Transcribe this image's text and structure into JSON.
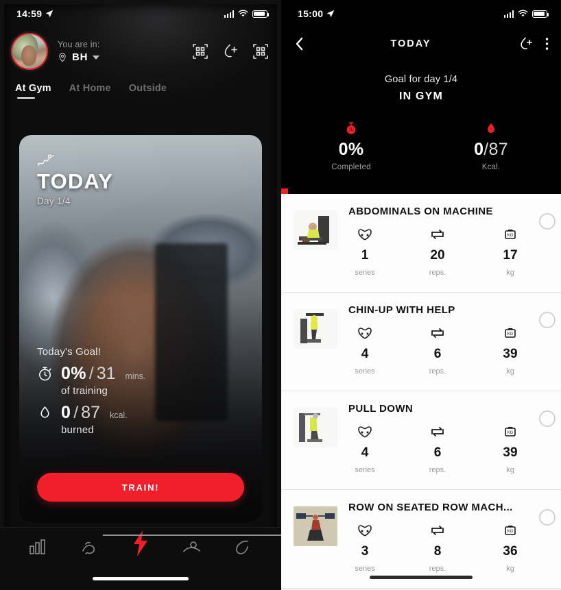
{
  "left_phone": {
    "status_bar": {
      "time": "14:59",
      "location_arrow_icon": "location-arrow-icon",
      "signal_icon": "cellular-signal-icon",
      "wifi_icon": "wifi-icon",
      "battery_icon": "battery-full-icon"
    },
    "profile": {
      "avatar_icon": "user-avatar",
      "you_are_in_label": "You are in:",
      "location_pin_icon": "location-pin-icon",
      "city": "BH",
      "dropdown_icon": "chevron-down-icon"
    },
    "header_actions": [
      {
        "name": "qr-code-icon",
        "label": "qr-code-icon"
      },
      {
        "name": "add-water-icon",
        "label": "add-water-icon"
      },
      {
        "name": "qr-scan-icon",
        "label": "qr-scan-icon"
      }
    ],
    "tabs": [
      {
        "label": "At Gym",
        "active": true
      },
      {
        "label": "At Home",
        "active": false
      },
      {
        "label": "Outside",
        "active": false
      }
    ],
    "card": {
      "badge_icon": "gym-machine-icon",
      "title": "TODAY",
      "day": "Day 1/4",
      "goal_heading": "Today's Goal!",
      "time_icon": "stopwatch-icon",
      "time_value": "0%",
      "time_separator": "/",
      "time_total": "31",
      "time_unit": "mins.",
      "time_caption": "of training",
      "kcal_icon": "flame-drop-icon",
      "kcal_value": "0",
      "kcal_separator": "/",
      "kcal_total": "87",
      "kcal_unit": "kcal.",
      "kcal_caption": "burned",
      "train_button": "TRAIN!"
    },
    "bottom_nav": [
      {
        "name": "stats-bars-icon",
        "active": false
      },
      {
        "name": "muscle-arm-icon",
        "active": false
      },
      {
        "name": "lightning-bolt-icon",
        "active": true
      },
      {
        "name": "nutrition-icon",
        "active": false
      },
      {
        "name": "profile-body-icon",
        "active": false
      }
    ],
    "home_indicator": "home-indicator"
  },
  "right_phone": {
    "status_bar": {
      "time": "15:00",
      "location_arrow_icon": "location-arrow-icon",
      "signal_icon": "cellular-signal-icon",
      "wifi_icon": "wifi-icon",
      "battery_icon": "battery-full-icon"
    },
    "nav": {
      "back_icon": "chevron-left-icon",
      "title": "TODAY",
      "add_water_icon": "add-water-icon",
      "more_icon": "more-vertical-icon"
    },
    "goal_for_day": "Goal for day 1/4",
    "workout_location": "IN GYM",
    "stats": [
      {
        "icon": "stopwatch-icon",
        "value": "0%",
        "denominator": "",
        "label": "Completed"
      },
      {
        "icon": "flame-drop-icon",
        "value": "0",
        "denominator": "/87",
        "label": "Kcal."
      }
    ],
    "exercises": [
      {
        "thumb_icon": "abdominal-machine-thumb",
        "name": "ABDOMINALS ON MACHINE",
        "metrics": [
          {
            "icon": "muscle-group-icon",
            "value": "1",
            "label": "series"
          },
          {
            "icon": "repeat-icon",
            "value": "20",
            "label": "reps."
          },
          {
            "icon": "weight-icon",
            "value": "17",
            "label": "kg"
          }
        ],
        "checkbox": "exercise-checkbox"
      },
      {
        "thumb_icon": "chin-up-machine-thumb",
        "name": "CHIN-UP WITH HELP",
        "metrics": [
          {
            "icon": "muscle-group-icon",
            "value": "4",
            "label": "series"
          },
          {
            "icon": "repeat-icon",
            "value": "6",
            "label": "reps."
          },
          {
            "icon": "weight-icon",
            "value": "39",
            "label": "kg"
          }
        ],
        "checkbox": "exercise-checkbox"
      },
      {
        "thumb_icon": "pull-down-machine-thumb",
        "name": "PULL DOWN",
        "metrics": [
          {
            "icon": "muscle-group-icon",
            "value": "4",
            "label": "series"
          },
          {
            "icon": "repeat-icon",
            "value": "6",
            "label": "reps."
          },
          {
            "icon": "weight-icon",
            "value": "39",
            "label": "kg"
          }
        ],
        "checkbox": "exercise-checkbox"
      },
      {
        "thumb_icon": "seated-row-machine-thumb",
        "name": "ROW ON SEATED ROW MACH...",
        "metrics": [
          {
            "icon": "muscle-group-icon",
            "value": "3",
            "label": "series"
          },
          {
            "icon": "repeat-icon",
            "value": "8",
            "label": "reps."
          },
          {
            "icon": "weight-icon",
            "value": "36",
            "label": "kg"
          }
        ],
        "checkbox": "exercise-checkbox"
      }
    ],
    "scroll_indicator": "scroll-indicator"
  },
  "colors": {
    "accent_red": "#f01f2a",
    "dark_bg": "#0d0d0d",
    "list_bg": "#fdfdfd"
  }
}
